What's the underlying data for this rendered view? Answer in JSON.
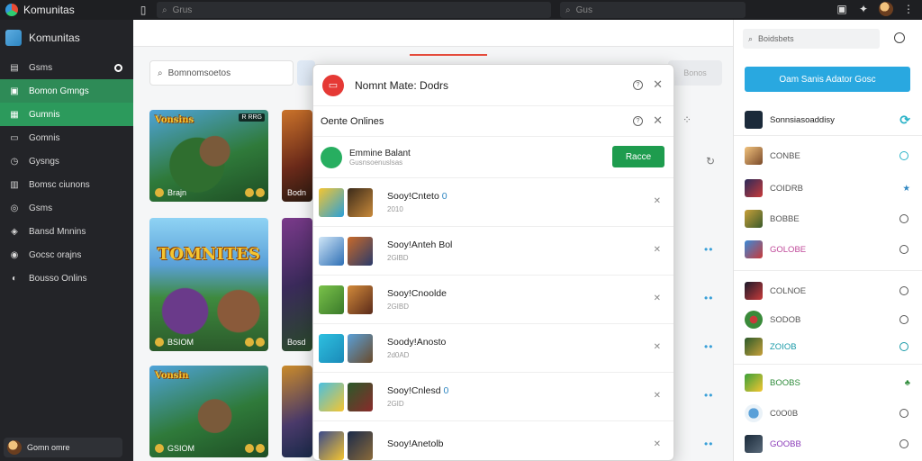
{
  "topbar": {
    "app_name": "Komunitas",
    "search_placeholder": "Grus",
    "search2_placeholder": "Gus"
  },
  "sidebar": {
    "title": "Komunitas",
    "items": [
      {
        "label": "Gsms",
        "icon": "grid-icon"
      },
      {
        "label": "Bomon Gmngs",
        "icon": "chat-icon"
      },
      {
        "label": "Gumnis",
        "icon": "group-icon"
      },
      {
        "label": "Gomnis",
        "icon": "folder-icon"
      },
      {
        "label": "Gysngs",
        "icon": "clock-icon"
      },
      {
        "label": "Bomsc ciunons",
        "icon": "bag-icon"
      },
      {
        "label": "Gsms",
        "icon": "globe-icon"
      },
      {
        "label": "Bansd Mnnins",
        "icon": "shield-icon"
      },
      {
        "label": "Gocsc orajns",
        "icon": "pin-icon"
      },
      {
        "label": "Bousso Onlins",
        "icon": "people-icon"
      }
    ],
    "user_name": "Gomn omre"
  },
  "main": {
    "search_placeholder": "Bomnomsoetos",
    "right_tab": "Bonos",
    "cards": [
      {
        "title": "Vonsins",
        "caption": "Brajn",
        "badge": "R RRG"
      },
      {
        "title": "",
        "caption": "Bodn",
        "badge": ""
      },
      {
        "title": "TOMNITES",
        "caption": "BSIOM",
        "badge": ""
      },
      {
        "title": "",
        "caption": "Bosd",
        "badge": ""
      },
      {
        "title": "Vonsin",
        "caption": "GSIOM",
        "badge": ""
      },
      {
        "title": "",
        "caption": "",
        "badge": ""
      }
    ]
  },
  "modal": {
    "title": "Nomnt Mate: Dodrs",
    "subtitle": "Oente Onlines",
    "add": {
      "title": "Emmine Balant",
      "sub": "Gusnsoenuslsas",
      "button": "Racce"
    },
    "rows": [
      {
        "name": "Sooy!Cnteto",
        "sub": "2010"
      },
      {
        "name": "Sooy!Anteh Bol",
        "sub": "2GlBD"
      },
      {
        "name": "Sooy!Cnoolde",
        "sub": "2GIBD"
      },
      {
        "name": "Soody!Anosto",
        "sub": "2d0AD"
      },
      {
        "name": "Sooy!Cnlesd",
        "sub": "2GID"
      },
      {
        "name": "Sooy!Anetolb",
        "sub": ""
      }
    ]
  },
  "rpanel": {
    "search_placeholder": "Boidsbets",
    "button": "Oam Sanis Adator Gosc",
    "top_row": "Sonnsiasoaddisy",
    "rows": [
      {
        "name": "CONBE"
      },
      {
        "name": "COIDRB"
      },
      {
        "name": "BOBBE"
      },
      {
        "name": "GOLOBE"
      },
      {
        "name": "COLNOE"
      },
      {
        "name": "SODOB"
      },
      {
        "name": "ZOIOB"
      },
      {
        "name": "BOOBS"
      },
      {
        "name": "C0O0B"
      },
      {
        "name": "GOOBB"
      }
    ]
  }
}
